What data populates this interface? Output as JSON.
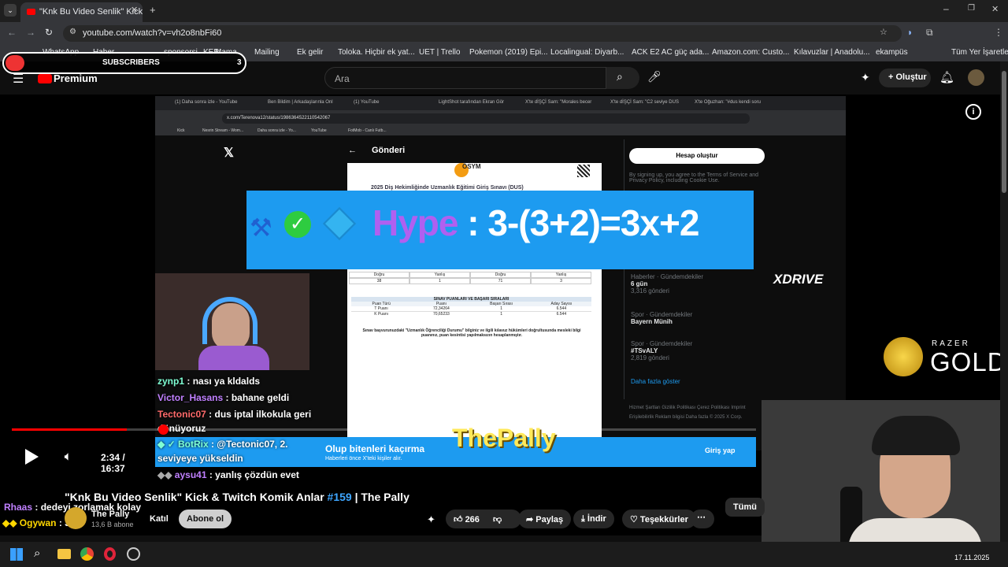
{
  "browser": {
    "tab_title": "\"Knk Bu Video Senlik\" Kick & Tw",
    "url": "youtube.com/watch?v=vh2o8nbFi60",
    "bookmarks": [
      "WhatsApp",
      "Haber",
      "sponsorsi",
      "KEP",
      "Mama",
      "Mailing",
      "Ek gelir",
      "Toloka. Hiçbir ek yat...",
      "UET | Trello",
      "Pokemon (2019) Epi...",
      "Localingual: Diyarb...",
      "ACK E2 AC güç ada...",
      "Amazon.com: Custo...",
      "Kılavuzlar | Anadolu...",
      "ekampüs",
      "Tüm Yer İşaretleri"
    ],
    "subscribers_overlay": "SUBSCRIBERS",
    "subscribers_count": "3"
  },
  "youtube": {
    "logo_text": "Premium",
    "search_placeholder": "Ara",
    "create_label": "Oluştur"
  },
  "inner_browser": {
    "tabs": [
      "(1) Daha sonra izle - YouTube",
      "Ben Bildim | Arkadaşlarınla Onl",
      "(1) YouTube",
      "LightShot tarafından Ekran Gör",
      "X'te dİŞÇİ Sam: \"Morales becer",
      "X'te dİŞÇİ Sam: \"C2 seviye DUS",
      "X'te Oğuzhan: \"#dus kendi soru"
    ],
    "url": "x.com/Terenova12/status/1986364522110542067",
    "bookmarks": [
      "Kick",
      "Nesrin Stream - Wom...",
      "Daha sonra izle - Yo...",
      "YouTube",
      "FotMob - Canlı Futb..."
    ],
    "post_header": "Gönderi",
    "doc_logo": "ÖSYM",
    "doc_title": "2025 Diş Hekimliğinde Uzmanlık Eğitimi Giriş Sınavı (DUS)",
    "doc_table_head": [
      "Doğru",
      "Yanlış",
      "Doğru",
      "Yanlış"
    ],
    "doc_table_vals": [
      "38",
      "1",
      "71",
      "3"
    ],
    "doc_results_title": "SINAV PUANLARI VE BAŞARI SIRALARI",
    "doc_results_head": [
      "Puan Türü",
      "Puanı",
      "Başarı Sırası",
      "Aday Sayısı"
    ],
    "doc_results_rows": [
      [
        "T Puanı",
        "72,34264",
        "1",
        "6.544"
      ],
      [
        "K Puanı",
        "70,65233",
        "1",
        "6.544"
      ]
    ],
    "doc_note": "Sınav başvurunuzdaki \"Uzmanlık Öğrenciliği Durumu\" bilginiz ve ilgili kılavuz hükümleri doğrultusunda mesleki bilgi puanınız, puan kesintisi yapılmaksızın hesaplanmıştır.",
    "right_button": "Hesap oluştur",
    "right_terms": "By signing up, you agree to the Terms of Service and Privacy Policy, including Cookie Use.",
    "trends": [
      {
        "cat": "Haberler · Gündemdekiler",
        "name": "6 gün",
        "count": "3,316 gönderi"
      },
      {
        "cat": "Spor · Gündemdekiler",
        "name": "Bayern Münih",
        "count": ""
      },
      {
        "cat": "Spor · Gündemdekiler",
        "name": "#TSvALY",
        "count": "2,819 gönderi"
      }
    ],
    "show_more": "Daha fazla göster",
    "footer_links": "Hizmet Şartları   Gizlilik Politikası   Çerez Politikası   Imprint   Erişilebilirlik   Reklam bilgisi   Daha fazla   © 2025 X Corp.",
    "banner_title": "Olup bitenleri kaçırma",
    "banner_sub": "Haberleri önce X'teki kişiler alır.",
    "banner_login": "Giriş yap"
  },
  "overlay": {
    "hype_label": "Hype",
    "hype_text": ": 3-(3+2)=3x+2",
    "watermark": "ThePally",
    "xdrive": "XDRIVE",
    "razer_small": "RAZER",
    "razer_gold": "GOLD"
  },
  "chat": [
    {
      "user": "zynp1",
      "user_color": "#7fffd4",
      "msg": ": nası ya kldalds"
    },
    {
      "user": "Victor_Hasans",
      "user_color": "#c080ff",
      "msg": ": bahane geldi"
    },
    {
      "user": "Tectonic07",
      "user_color": "#ff6a6a",
      "msg": ": dus iptal ilkokula geri"
    },
    {
      "user": "",
      "user_color": "#ffffff",
      "msg": "dönüyoruz"
    },
    {
      "user": "BotRix",
      "user_color": "#7fffd4",
      "msg": ": @Tectonic07, 2."
    },
    {
      "user": "",
      "user_color": "#ffffff",
      "msg": "seviyeye yükseldin"
    },
    {
      "user": "aysu41",
      "user_color": "#c080ff",
      "msg": ": yanlış çözdün evet"
    },
    {
      "user": "Rhaas",
      "user_color": "#c080ff",
      "msg": ": dedeyi zorlamak kolay"
    },
    {
      "user": "Ogywan",
      "user_color": "#ffd700",
      "msg": ": 31"
    }
  ],
  "player": {
    "time": "2:34 / 16:37",
    "progress": 0.154
  },
  "video": {
    "title_main": "\"Knk Bu Video Senlik\" Kick & Twitch Komik Anlar ",
    "title_hash": "#159",
    "title_tail": " | The Pally",
    "channel": "The Pally",
    "subs": "13,6 B abone",
    "join": "Katıl",
    "subscribe": "Abone ol",
    "likes": "266",
    "share": "Paylaş",
    "download": "İndir",
    "thanks": "Teşekkürler",
    "more": "Tümü"
  },
  "taskbar": {
    "date": "17.11.2025"
  }
}
